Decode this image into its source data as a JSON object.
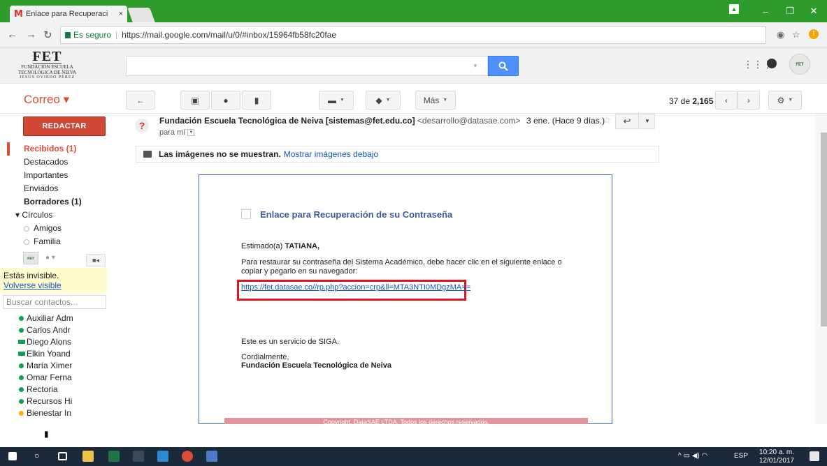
{
  "browser": {
    "tab_title": "Enlace para Recuperació",
    "tab_close": "×",
    "secure_label": "Es seguro",
    "url": "https://mail.google.com/mail/u/0/#inbox/15964fb58fc20fae"
  },
  "logo": {
    "title": "FET",
    "line1": "FUNDACIÓN ESCUELA",
    "line2": "TECNOLÓGICA DE NEIVA",
    "line3": "JESÚS OVIEDO PÉREZ"
  },
  "toolbar": {
    "app_label": "Correo ▾",
    "more_label": "Más",
    "count_prefix": "37 de ",
    "count_total": "2,165"
  },
  "sidebar": {
    "compose_label": "REDACTAR",
    "items": [
      {
        "label": "Recibidos (1)"
      },
      {
        "label": "Destacados"
      },
      {
        "label": "Importantes"
      },
      {
        "label": "Enviados"
      },
      {
        "label": "Borradores (1)"
      },
      {
        "label": "▾ Círculos"
      },
      {
        "label": "Amigos"
      },
      {
        "label": "Familia"
      }
    ],
    "invisible_text": "Estás invisible.",
    "visible_link": "Volverse visible",
    "contact_search_placeholder": "Buscar contactos...",
    "contacts": [
      {
        "name": "Auxiliar Adm"
      },
      {
        "name": "Carlos Andr"
      },
      {
        "name": "Diego Alons"
      },
      {
        "name": "Elkin Yoand"
      },
      {
        "name": "María Ximer"
      },
      {
        "name": "Omar Ferna"
      },
      {
        "name": "Rectoria"
      },
      {
        "name": "Recursos Hi"
      },
      {
        "name": "Bienestar In"
      }
    ]
  },
  "email": {
    "sender_name": "Fundación Escuela Tecnológica de Neiva [sistemas@fet.edu.co]",
    "sender_addr": "<desarrollo@datasae.com>",
    "to": "para mí",
    "date": "3 ene. (Hace 9 días.)",
    "images_notice": "Las imágenes no se muestran.",
    "images_link": "Mostrar imágenes debajo",
    "title": "Enlace para Recuperación de su Contraseña",
    "greeting_prefix": "Estimado(a) ",
    "greeting_name": "TATIANA,",
    "paragraph": "Para restaurar su contraseña del Sistema Académico, debe hacer clic en el siguiente enlace o copiar y pegarlo en su navegador:",
    "reset_link": "https://fet.datasae.co//rp.php?accion=crp&ll=MTA3NTI0MDgzMA==",
    "service": "Este es un servicio de SIGA.",
    "regards": "Cordialmente,",
    "signature": "Fundación Escuela Tecnológica de Neiva",
    "copyright": "Copyright, DataSAE LTDA, Todos los derechos reservados."
  },
  "taskbar": {
    "lang": "ESP",
    "time": "10:20 a. m.",
    "date": "12/01/2017"
  },
  "colors": {
    "chrome_green": "#2e9c2a",
    "compose_red": "#d14836",
    "link_blue": "#1155cc",
    "highlight_red": "#e0131e"
  }
}
